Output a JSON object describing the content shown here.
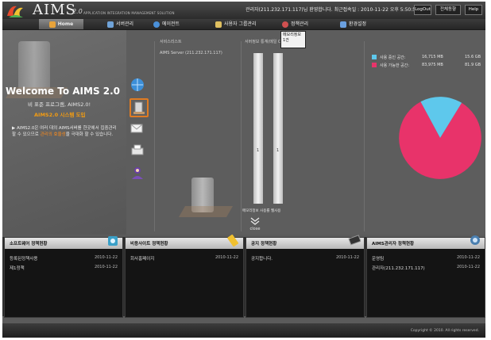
{
  "header": {
    "logo_text": "AIMS",
    "logo_version": "2.0",
    "logo_subtitle": "APPLICATION INTEGRATION MANAGEMENT SOLUTION",
    "welcome_message": "관리자(211.232.171.117)님 환영합니다. 최근접속일 : 2010-11-22 오후 5:50:50",
    "buttons": [
      "LogOut",
      "전체동향",
      "Help"
    ]
  },
  "tabs": [
    {
      "label": "Home",
      "icon": "home-icon",
      "color": "#e8a33a"
    },
    {
      "label": "서버관리",
      "icon": "server-icon",
      "color": "#6fa3d8"
    },
    {
      "label": "에이전트",
      "icon": "globe-icon",
      "color": "#4a90d9"
    },
    {
      "label": "사용자 그룹관리",
      "icon": "users-icon",
      "color": "#e0c060"
    },
    {
      "label": "정책관리",
      "icon": "policy-icon",
      "color": "#d05050"
    },
    {
      "label": "환경설정",
      "icon": "settings-icon",
      "color": "#6aa0e0"
    }
  ],
  "hero": {
    "title": "Welcome To AIMS 2.0",
    "subtitle": "비 표준 프로그램, AIMS2.0!",
    "highlight": "AIMS2.0 시스템 도입",
    "description_pre": "▶ AIMS2.0은 여러 대의 AIMS서버를 한곳에서 집중관리 할 수 있으므로 ",
    "description_hl": "관리의 효율성",
    "description_post": "을 극대화 할 수 있습니다."
  },
  "side_icons": [
    "globe-icon",
    "server-config-icon",
    "mail-icon",
    "printer-icon",
    "user-icon"
  ],
  "services": {
    "label": "서비스리스트",
    "server_entry": "AIMS Server (211.232.171.117)"
  },
  "usage_chart": {
    "title": "서버정보 통계(메일 CPU 사용량)",
    "tooltip_line1": "메모리정보",
    "tooltip_line2": "1건",
    "bars": [
      {
        "name": "bar-1",
        "value": "1"
      },
      {
        "name": "bar-2",
        "value": "1"
      }
    ],
    "bar_labels": "메모리정보 사용률  웹사용",
    "close_label": "close"
  },
  "disk_usage": {
    "legend": [
      {
        "label": "사용 중인 공간:",
        "value": "16,715 MB",
        "gb": "15.6 GB",
        "color": "#5ec8ec"
      },
      {
        "label": "사용 가능한 공간:",
        "value": "83,975 MB",
        "gb": "81.9 GB",
        "color": "#e8336a"
      }
    ]
  },
  "chart_data": {
    "type": "pie",
    "title": "",
    "slices": [
      {
        "label": "사용 중인 공간",
        "value": 16715,
        "unit": "MB",
        "color": "#5ec8ec"
      },
      {
        "label": "사용 가능한 공간",
        "value": 83975,
        "unit": "MB",
        "color": "#e8336a"
      }
    ]
  },
  "panels": [
    {
      "title": "소프트웨어 정책현황",
      "icon": "software-icon",
      "rows": [
        {
          "label": "등록된정책사용",
          "date": "2010-11-22"
        },
        {
          "label": "제1정책",
          "date": "2010-11-22"
        }
      ]
    },
    {
      "title": "비용사이트 정책현황",
      "icon": "usb-icon",
      "rows": [
        {
          "label": "회사홈페이지",
          "date": "2010-11-22"
        }
      ]
    },
    {
      "title": "공지 정책현황",
      "icon": "notice-icon",
      "rows": [
        {
          "label": "공지합니다.",
          "date": "2010-11-22"
        }
      ]
    },
    {
      "title": "AIMS관리자 정책현황",
      "icon": "monitor-icon",
      "rows": [
        {
          "label": "운영팀",
          "date": "2010-11-22"
        },
        {
          "label": "관리자(211.232.171.117)",
          "date": "2010-11-22"
        }
      ]
    }
  ],
  "footer": {
    "copyright": "Copyright © 2010. All rights reserved."
  }
}
